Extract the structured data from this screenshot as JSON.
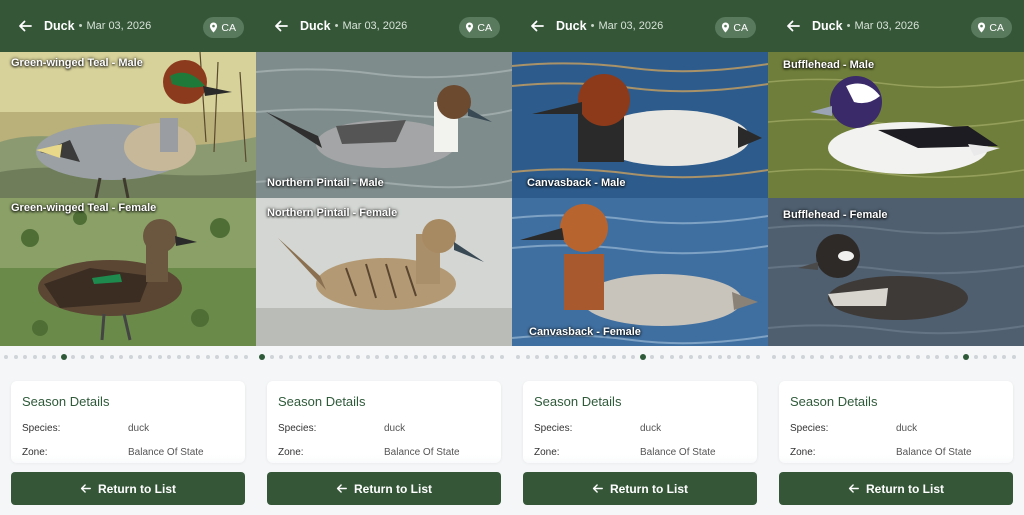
{
  "header": {
    "title": "Duck",
    "separator": "•",
    "date": "Mar 03, 2026",
    "state": "CA"
  },
  "details": {
    "heading": "Season Details",
    "rows": [
      {
        "label": "Species:",
        "value": "duck"
      },
      {
        "label": "Zone:",
        "value": "Balance Of State"
      }
    ]
  },
  "return_label": "Return to List",
  "colors": {
    "header_bg": "#355738",
    "button_bg": "#355738",
    "accent_text": "#2f5a3a",
    "page_bg": "#f4f6f8"
  },
  "panels": [
    {
      "photos": [
        {
          "caption": "Green-winged Teal - Male"
        },
        {
          "caption": "Green-winged Teal - Female"
        }
      ],
      "carousel_total": 26,
      "carousel_active": 7
    },
    {
      "photos": [
        {
          "caption": "Northern Pintail - Male"
        },
        {
          "caption": "Northern Pintail - Female"
        }
      ],
      "carousel_total": 26,
      "carousel_active": 1
    },
    {
      "photos": [
        {
          "caption": "Canvasback - Male"
        },
        {
          "caption": "Canvasback - Female"
        }
      ],
      "carousel_total": 26,
      "carousel_active": 14
    },
    {
      "photos": [
        {
          "caption": "Bufflehead - Male"
        },
        {
          "caption": "Bufflehead - Female"
        }
      ],
      "carousel_total": 26,
      "carousel_active": 21
    }
  ]
}
